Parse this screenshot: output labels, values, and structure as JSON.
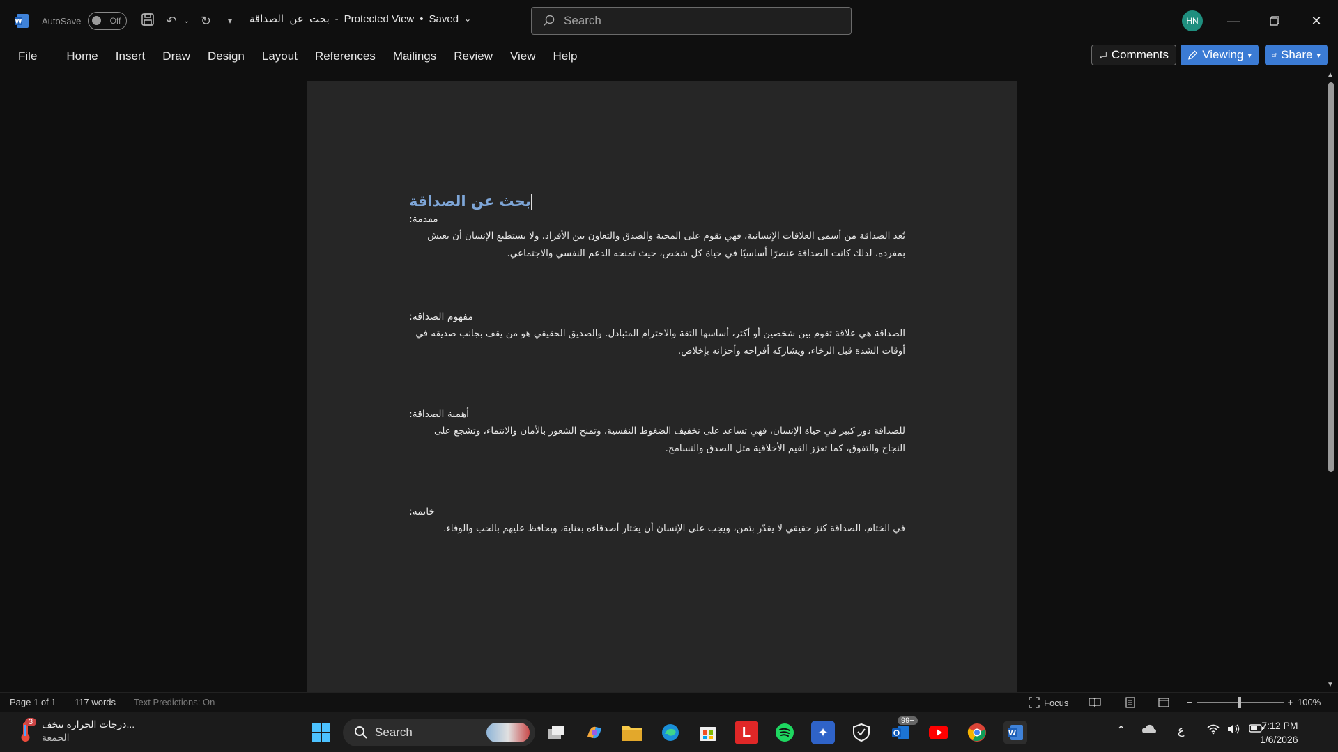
{
  "titlebar": {
    "autosave_label": "AutoSave",
    "autosave_state": "Off",
    "doc_name": "بحث_عن_الصداقة",
    "separator": "-",
    "mode": "Protected View",
    "dot": "•",
    "save_state": "Saved",
    "search_placeholder": "Search",
    "user_initials": "HN"
  },
  "ribbon": {
    "tabs": [
      "File",
      "Home",
      "Insert",
      "Draw",
      "Design",
      "Layout",
      "References",
      "Mailings",
      "Review",
      "View",
      "Help"
    ],
    "comments_label": "Comments",
    "viewing_label": "Viewing",
    "share_label": "Share"
  },
  "document": {
    "title": "بحث عن الصداقة",
    "sections": [
      {
        "heading": "مقدمة:",
        "body": "تُعد الصداقة من أسمى العلاقات الإنسانية، فهي تقوم على المحبة والصدق والتعاون بين الأفراد. ولا يستطيع الإنسان أن يعيش بمفرده، لذلك كانت الصداقة عنصرًا أساسيًا في حياة كل شخص، حيث تمنحه الدعم النفسي والاجتماعي."
      },
      {
        "heading": "مفهوم الصداقة:",
        "body": "الصداقة هي علاقة تقوم بين شخصين أو أكثر، أساسها الثقة والاحترام المتبادل. والصديق الحقيقي هو من يقف بجانب صديقه في أوقات الشدة قبل الرخاء، ويشاركه أفراحه وأحزانه بإخلاص."
      },
      {
        "heading": "أهمية الصداقة:",
        "body": "للصداقة دور كبير في حياة الإنسان، فهي تساعد على تخفيف الضغوط النفسية، وتمنح الشعور بالأمان والانتماء، وتشجع على النجاح والتفوق، كما تعزز القيم الأخلاقية مثل الصدق والتسامح."
      },
      {
        "heading": "خاتمة:",
        "body": "في الختام، الصداقة كنز حقيقي لا يقدّر بثمن، ويجب على الإنسان أن يختار أصدقاءه بعناية، ويحافظ عليهم بالحب والوفاء."
      }
    ]
  },
  "statusbar": {
    "page": "Page 1 of 1",
    "words": "117 words",
    "predictions": "Text Predictions: On",
    "focus": "Focus",
    "zoom": "100%"
  },
  "taskbar": {
    "weather_text": "درجات الحرارة تنخف...",
    "weather_day": "الجمعة",
    "weather_badge": "3",
    "search_label": "Search",
    "outlook_badge": "99+",
    "lang": "ع",
    "time": "7:12 PM",
    "date": "1/6/2026"
  },
  "colors": {
    "accent": "#3b7bd4",
    "heading": "#7ea6d8",
    "page": "#262626",
    "background": "#0f0f0f"
  }
}
